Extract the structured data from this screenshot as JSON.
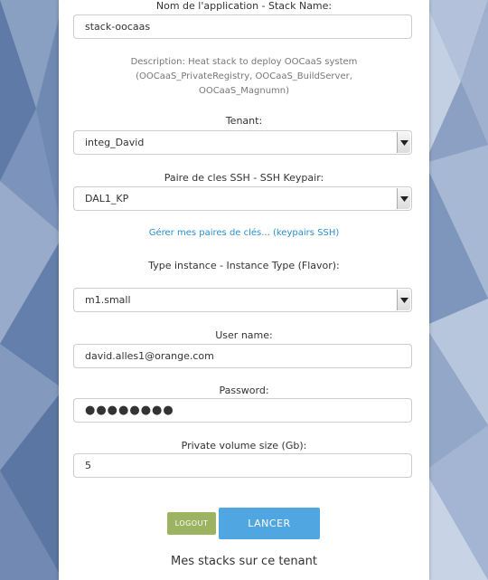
{
  "colors": {
    "accent": "#4fa6e0",
    "logout": "#9cb361",
    "link": "#2a8fc7",
    "background": "#6f89b2"
  },
  "form": {
    "app_name": {
      "label": "Nom de l'application - Stack Name:",
      "value": "stack-oocaas"
    },
    "description": "Description: Heat stack to deploy OOCaaS system (OOCaaS_PrivateRegistry, OOCaaS_BuildServer, OOCaaS_Magnumn)",
    "tenant": {
      "label": "Tenant:",
      "value": "integ_David",
      "icon": "chevron-down-icon"
    },
    "keypair": {
      "label": "Paire de cles SSH - SSH Keypair:",
      "value": "DAL1_KP",
      "icon": "chevron-down-icon"
    },
    "manage_keypairs_link": "Gérer mes paires de clés... (keypairs SSH)",
    "flavor": {
      "label": "Type instance - Instance Type (Flavor):",
      "value": "m1.small",
      "icon": "chevron-down-icon"
    },
    "username": {
      "label": "User name:",
      "value": "david.alles1@orange.com"
    },
    "password": {
      "label": "Password:",
      "value": "●●●●●●●●"
    },
    "volume": {
      "label": "Private volume size (Gb):",
      "value": "5"
    }
  },
  "buttons": {
    "logout": "LOGOUT",
    "launch": "LANCER"
  },
  "stacks_section_title": "Mes stacks sur ce tenant"
}
